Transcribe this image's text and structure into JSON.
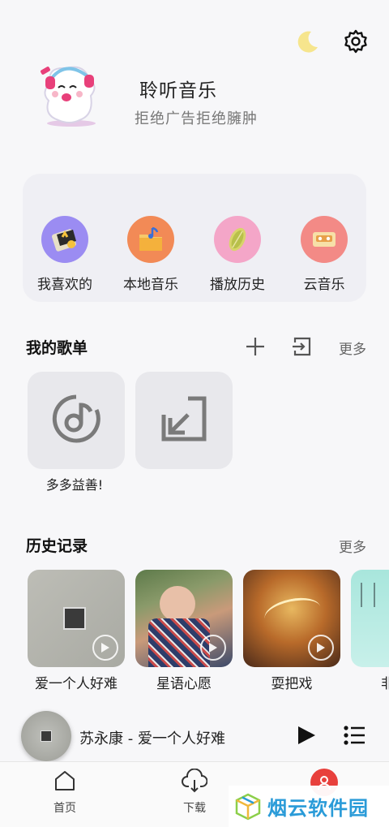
{
  "header": {
    "theme_icon": "moon-icon",
    "settings_icon": "gear-icon"
  },
  "brand": {
    "title": "聆听音乐",
    "subtitle": "拒绝广告拒绝臃肿"
  },
  "quick_actions": [
    {
      "label": "我喜欢的",
      "icon": "favorites-icon",
      "color": "#9b8cf2"
    },
    {
      "label": "本地音乐",
      "icon": "local-music-icon",
      "color": "#f28a56"
    },
    {
      "label": "播放历史",
      "icon": "history-icon",
      "color": "#f4a6c8"
    },
    {
      "label": "云音乐",
      "icon": "cloud-music-icon",
      "color": "#f38a86"
    }
  ],
  "my_playlists": {
    "title": "我的歌单",
    "more": "更多",
    "items": [
      {
        "name": "多多益善!",
        "icon": "music-disc-icon"
      },
      {
        "name": "",
        "icon": "import-icon"
      }
    ]
  },
  "history": {
    "title": "历史记录",
    "more": "更多",
    "items": [
      {
        "name": "爱一个人好难"
      },
      {
        "name": "星语心愿"
      },
      {
        "name": "耍把戏"
      },
      {
        "name": "非"
      }
    ]
  },
  "mini_player": {
    "now_playing": "苏永康 - 爱一个人好难"
  },
  "tabs": [
    {
      "label": "首页",
      "icon": "home-icon"
    },
    {
      "label": "下载",
      "icon": "cloud-download-icon"
    },
    {
      "label": "",
      "icon": "profile-icon"
    }
  ],
  "watermark": {
    "text": "烟云软件园"
  },
  "colors": {
    "accent_red": "#e8403c",
    "moon": "#f6e58d"
  }
}
